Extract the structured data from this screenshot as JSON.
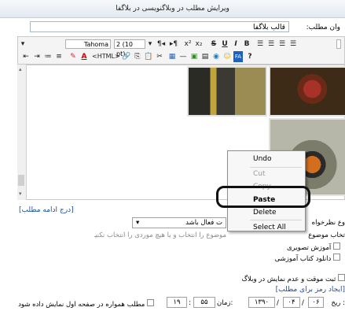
{
  "window_title": "ویرایش مطلب در وبلاگنویسی در بلاگفا",
  "title_label": "وان مطلب:",
  "title_value": "قالب بلاگفا",
  "toolbar": {
    "font_name": "Tahoma",
    "font_size": "2 (10 pt)",
    "html_label": "<HTML>",
    "help_label": "?"
  },
  "context_menu": {
    "undo": "Undo",
    "cut": "Cut",
    "copy": "Copy",
    "paste": "Paste",
    "delete": "Delete",
    "select_all": "Select All"
  },
  "continue_link": "[درج ادامه مطلب]",
  "comments_label": "وع نظرخواه",
  "comments_select": "ت فعال باشد",
  "category_label": "تخاب موضوع",
  "category_hint": "موضوع را انتخاب و یا هیچ موردی را انتخاب نکنید)",
  "categories": [
    "آموزش تصویری",
    "دانلود کتاب آموزشی"
  ],
  "temp_save_label": "ثبت موقت و عدم نمایش در وبلاگ",
  "password_link": "[ایجاد رمز برای مطلب]",
  "date_label": "ریخ :",
  "date_day": "۰۶",
  "date_month": "۰۴",
  "date_year": "۱۳۹۰",
  "time_label": "زمان:",
  "time_minute": "۵۵",
  "time_hour": "۱۹",
  "always_show_label": "مطلب همواره در صفحه اول نمایش داده شود"
}
